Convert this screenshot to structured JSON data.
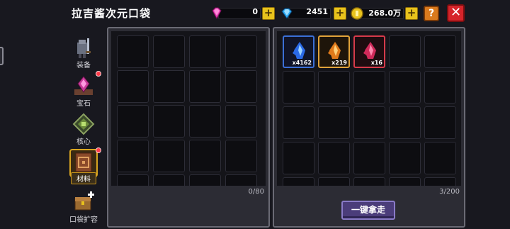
{
  "header": {
    "title": "拉吉酱次元口袋",
    "currencies": [
      {
        "name": "pink-gem",
        "icon": "pink-gem-icon",
        "value": "0"
      },
      {
        "name": "blue-diamond",
        "icon": "blue-diamond-icon",
        "value": "2451"
      },
      {
        "name": "gold-coin",
        "icon": "gold-coin-icon",
        "value": "268.0万"
      }
    ],
    "plus_label": "+",
    "help_label": "?",
    "close_label": "✕"
  },
  "sidebar": {
    "items": [
      {
        "label": "装备",
        "icon": "equipment-icon",
        "active": false,
        "badge": false
      },
      {
        "label": "宝石",
        "icon": "gem-icon",
        "active": false,
        "badge": true
      },
      {
        "label": "核心",
        "icon": "core-icon",
        "active": false,
        "badge": false
      },
      {
        "label": "材料",
        "icon": "material-book-icon",
        "active": true,
        "badge": true
      },
      {
        "label": "口袋扩容",
        "icon": "chest-expand-icon",
        "active": false,
        "badge": false
      }
    ]
  },
  "left_panel": {
    "count": "0/80"
  },
  "right_panel": {
    "count": "3/200",
    "items": [
      {
        "name": "blue-crystal",
        "icon": "blue-crystal-icon",
        "qty": "x4162",
        "rarity": "blue"
      },
      {
        "name": "orange-crystal",
        "icon": "orange-crystal-icon",
        "qty": "x219",
        "rarity": "orange"
      },
      {
        "name": "red-crystal",
        "icon": "red-crystal-icon",
        "qty": "x16",
        "rarity": "red"
      }
    ],
    "collect_all_label": "一键拿走"
  },
  "colors": {
    "background": "#18181f",
    "panel": "#2c2c34",
    "accent_gold": "#e8c21c",
    "close_red": "#d6242a",
    "button_purple": "#4b3d7a"
  }
}
